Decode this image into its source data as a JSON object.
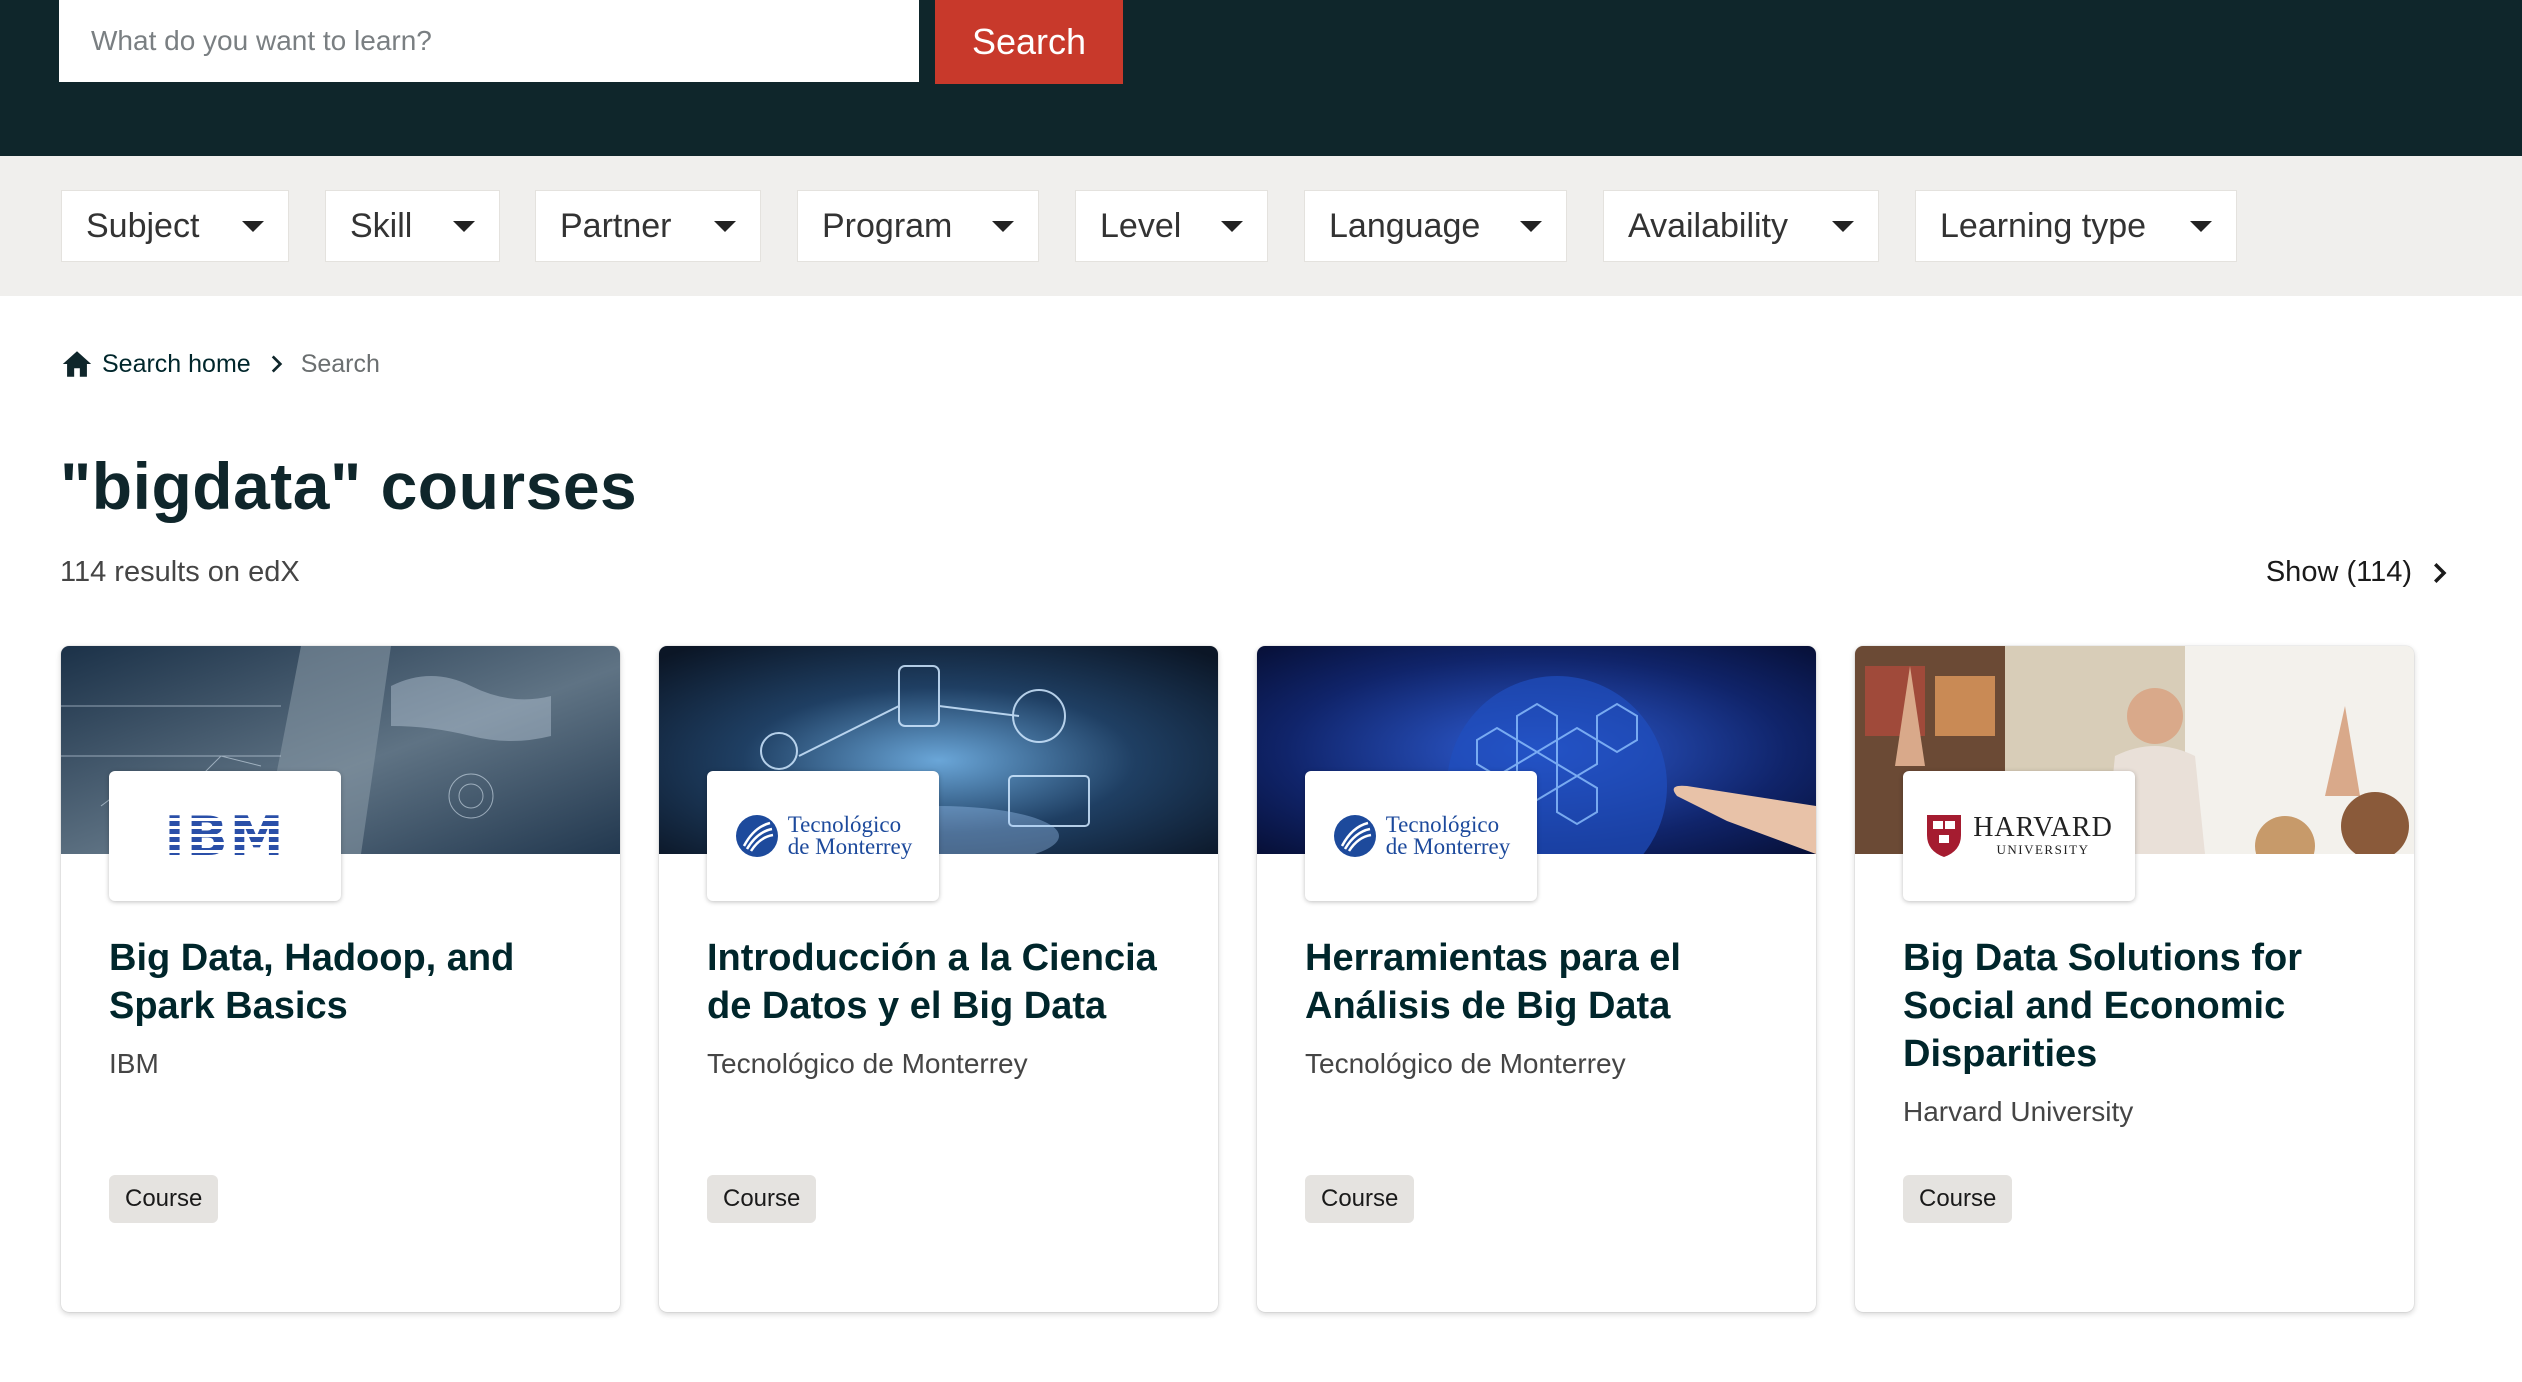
{
  "search": {
    "placeholder": "What do you want to learn?",
    "button_label": "Search"
  },
  "filters": [
    {
      "label": "Subject"
    },
    {
      "label": "Skill"
    },
    {
      "label": "Partner"
    },
    {
      "label": "Program"
    },
    {
      "label": "Level"
    },
    {
      "label": "Language"
    },
    {
      "label": "Availability"
    },
    {
      "label": "Learning type"
    }
  ],
  "breadcrumb": {
    "home": "Search home",
    "current": "Search"
  },
  "heading": {
    "title": "\"bigdata\" courses",
    "results_count": "114 results on edX",
    "show_link": "Show (114)"
  },
  "cards": [
    {
      "title": "Big Data, Hadoop, and Spark Basics",
      "org": "IBM",
      "badge": "Course",
      "logo_text": "IBM"
    },
    {
      "title": "Introducción a la Ciencia de Datos y el Big Data",
      "org": "Tecnológico de Monterrey",
      "badge": "Course",
      "logo_text_1": "Tecnológico",
      "logo_text_2": "de Monterrey"
    },
    {
      "title": "Herramientas para el Análisis de Big Data",
      "org": "Tecnológico de Monterrey",
      "badge": "Course",
      "logo_text_1": "Tecnológico",
      "logo_text_2": "de Monterrey"
    },
    {
      "title": "Big Data Solutions for Social and Economic Disparities",
      "org": "Harvard University",
      "badge": "Course",
      "logo_text_1": "HARVARD",
      "logo_text_2": "UNIVERSITY"
    }
  ],
  "colors": {
    "header_bg": "#0f262b",
    "search_button": "#c8392b",
    "filter_bar_bg": "#f0efed",
    "badge_bg": "#e5e3e0"
  }
}
